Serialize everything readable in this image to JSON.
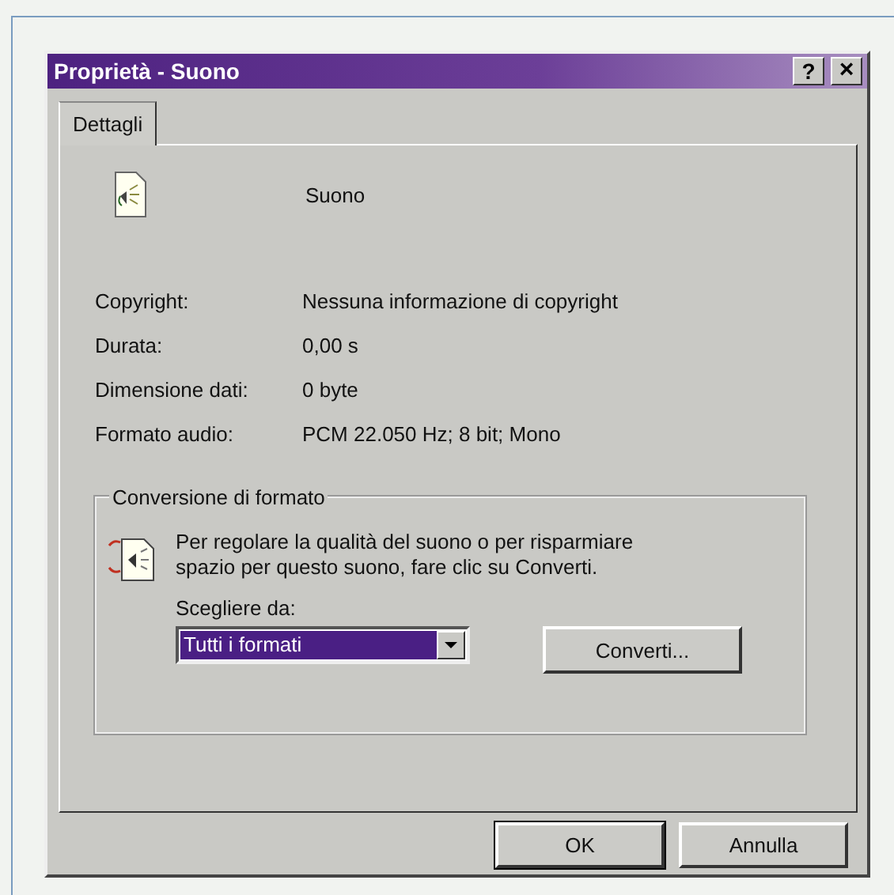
{
  "window": {
    "title": "Proprietà - Suono",
    "title_buttons": [
      {
        "kind": "help",
        "label": "?"
      },
      {
        "kind": "close",
        "label": "×"
      }
    ]
  },
  "tabs": [
    {
      "label": "Dettagli",
      "selected": true
    }
  ],
  "file": {
    "name": "Suono"
  },
  "properties": [
    {
      "label": "Copyright:",
      "value": "Nessuna informazione di copyright"
    },
    {
      "label": "Durata:",
      "value": "0,00 s"
    },
    {
      "label": "Dimensione dati:",
      "value": "0 byte"
    },
    {
      "label": "Formato audio:",
      "value": "PCM 22.050 Hz; 8 bit; Mono"
    }
  ],
  "conversion": {
    "title": "Conversione di formato",
    "description": "Per regolare la qualità del suono o per risparmiare spazio per questo suono, fare clic su Converti.",
    "combo_label": "Scegliere da:",
    "combo_value": "Tutti i formati",
    "convert_button": "Converti..."
  },
  "buttons": [
    "OK",
    "Annulla"
  ]
}
